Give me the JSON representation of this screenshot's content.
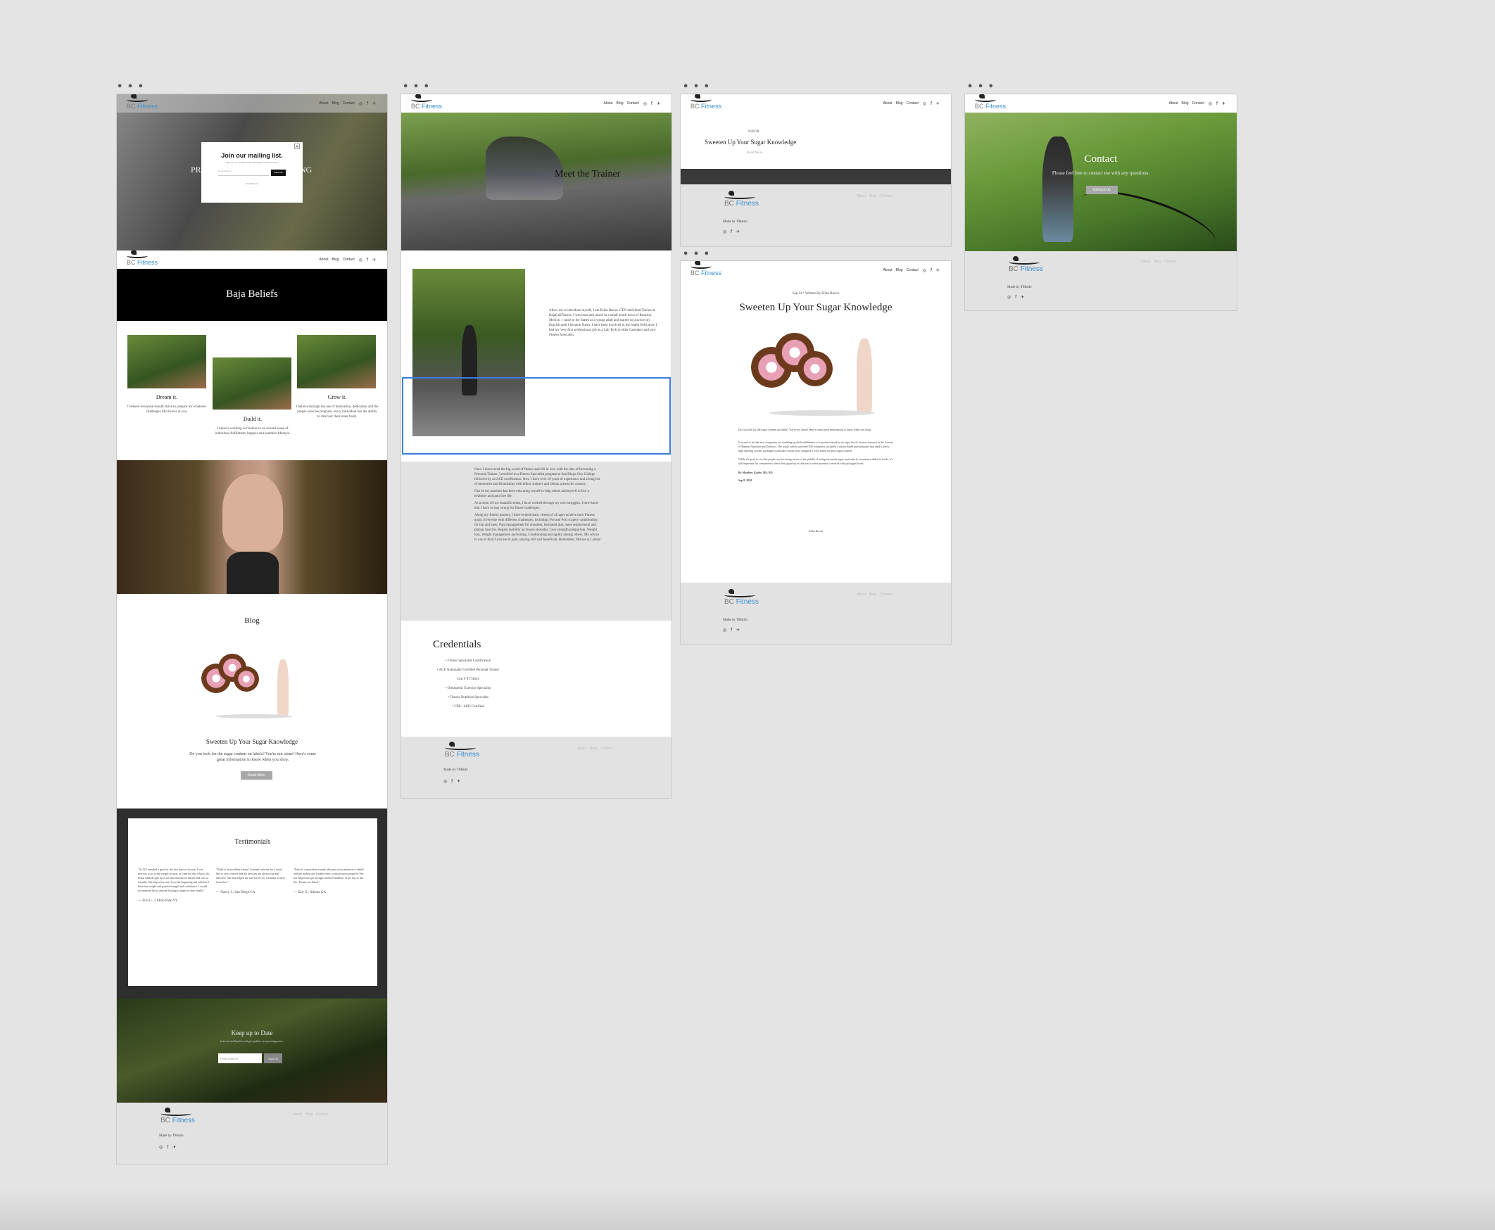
{
  "header": {
    "logo_prefix": "BC",
    "logo_brand": "Fitness",
    "nav": [
      "About",
      "Blog",
      "Contact"
    ],
    "social": "◎ f ✈"
  },
  "board1": {
    "popup": {
      "title": "Join our mailing list.",
      "subtitle": "Sign up to a complimentary consultation and 5* reviews",
      "email_placeholder": "Email Address",
      "button": "Subscribe",
      "no_thanks": "No thank you"
    },
    "hero_left_text": "PR",
    "hero_right_text": "NG",
    "beliefs_title": "Baja Beliefs",
    "beliefs": [
      {
        "title": "Dream it.",
        "text": "I believe everyone should strive to prepare for whatever challenges life throws at you."
      },
      {
        "title": "Build it.",
        "text": "I believe working our bodies to an overall sense of individual fulfillment, happier and healthier lifestyle."
      },
      {
        "title": "Grow it.",
        "text": "I believe through the use of motivation, dedication and the proper exercise program, every individual has the ability to discover their inner body."
      }
    ],
    "blog_title": "Blog",
    "blog_post_title": "Sweeten Up Your Sugar Knowledge",
    "blog_post_excerpt": "Do you look for the sugar content on labels? You're not alone! Here's some great information to know when you shop.",
    "blog_button": "Read More",
    "testimonials_title": "Testimonials",
    "testimonials": [
      {
        "text": "\"At 56 I enrolled a gym for the first time in 4 years! I was nervous to go to the weight section, as I had no idea what to do. Erika walked right up to me and introduced herself and was so friendly. She helped me start from the beginning and with her I have lost weight and gained strength and confidence. I would recommend her to anyone looking to improve their health.\"",
        "author": "— Erin G., Clifton Park NY"
      },
      {
        "text": "\"Erika is an excellent trainer! I trained with her for 2 years. She is very creative and the sessions are always fun and effective. She has helped me and I feel very fortunate to have found her.\"",
        "author": "— Nancy J., San Diego CA"
      },
      {
        "text": "\"Erika is a marvelous trainer, she pays close attention to detail and she makes sure I make every workout move properly. She has helped me get stronger and feel healthier in my day to day life. Thank you Erika!\"",
        "author": "— Earl G., Atlanta GA"
      }
    ],
    "keep_up_title": "Keep up to Date",
    "keep_up_subtitle": "Join our mailing list and get updates on upcoming news.",
    "keep_up_placeholder": "Email Address",
    "keep_up_button": "Sign Up",
    "made_by": "Made by TMstdo"
  },
  "board2": {
    "hero_title": "Meet the Trainer",
    "intro": "Allow me to introduce myself, I am Erika Bacon, CEO and Head Trainer at BajaCaliFitness. I was born and raised in a small beach town of Rosarito, Mexico. I came to the States as a young adult and started to practice my English until I became fluent. I have been involved in the health field since I had my very first professional job as a Lab Tech to elder Caretaker and now Fitness Specialist.",
    "story_1": "Once I discovered the big world of fitness and fell in love with the idea of becoming a Personal Trainer, I enrolled in a Fitness Specialist program at San Diego City College followed by an ACE certification. Now I have over 10 years of experience and a long list of memories and friendships with fellow trainers and clients across the country.",
    "story_2": "One of my passions has been educating myself to help others and myself to live a healthier and pain free life.",
    "story_3": "As a mom of two beautiful teens, I have worked through my own struggles, I now know that I have to stay strong for future challenges.",
    "story_4": "Along my fitness journey, I have helped many clients of all ages achieve their Fitness goals. Everyone with different challenges, including: Pre and Post surgery conditioning for hip and knee, Pain management for shoulder, herniated disk, knee replacement and plantar fasciitis, Regain mobility on frozen shoulder, Core strength postpartum, Weight loss, Weight management and toning, Conditioning and agility among others. My advice to you is that if you are in pain, staying still isn't beneficial. Remember, Motion is Lotion!",
    "credentials_title": "Credentials",
    "credentials": [
      "• Fitness Specialist Certification",
      "• ACE Nationally Certified Personal Trainer",
      "Cert # T174021",
      "• Orthopedic Exercise Specialist",
      "• Fitness Nutrition Specialist",
      "• CPR / AED Certified"
    ],
    "made_by": "Made by TMstdo"
  },
  "board3": {
    "small_label": "9/26/20",
    "post_title": "Sweeten Up Your Sugar Knowledge",
    "read_more": "Read More",
    "made_by": "Made by TMstdo"
  },
  "board4": {
    "meta": "Sep 24  •  Written By Erika Bacon",
    "title": "Sweeten Up Your Sugar Knowledge",
    "lead": "Do you look for the sugar content on labels? You're not alone! Here's some great information to know when you shop.",
    "p1": "It turned to be that new companies are doubling up the healthfulness of a product based on its sugar levels. In new research in the Journal of Human Nutrition and Dietetics. The study, which surveyed 500 volunteers, included a choice based questionnaire that used a traffic light labeling system, packaged foods like cereals were assigned a color based on their sugar content.",
    "p2": "While it's good to see that people are becoming aware of the pitfalls of eating too much sugar, particularly sweeteners added to foods, it's still important for consumers to have their guard up in relation to other potential concerns with packaged foods.",
    "byline": "By Matthew Kadey, MS, RD",
    "date": "Sep 8, 2020",
    "back": "Erika Bacon",
    "made_by": "Made by TMstdo"
  },
  "board5": {
    "title": "Contact",
    "subtitle": "Please feel free to contact me with any questions.",
    "button": "Contact Us",
    "made_by": "Made by TMstdo"
  }
}
